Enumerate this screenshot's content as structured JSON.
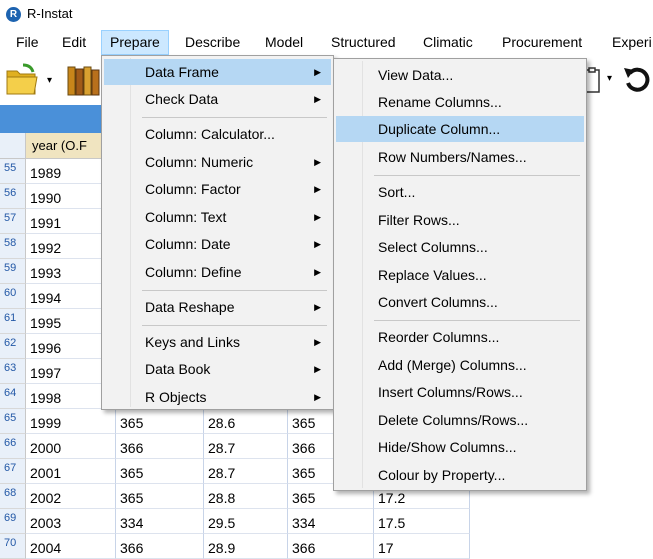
{
  "window": {
    "title": "R-Instat",
    "icon_letter": "R"
  },
  "menubar": [
    {
      "label": "File"
    },
    {
      "label": "Edit"
    },
    {
      "label": "Prepare"
    },
    {
      "label": "Describe"
    },
    {
      "label": "Model"
    },
    {
      "label": "Structured"
    },
    {
      "label": "Climatic"
    },
    {
      "label": "Procurement"
    },
    {
      "label": "Experi"
    }
  ],
  "toolbar": {
    "icons": [
      "open-folder-icon",
      "dropdown-arrow-icon",
      "books-icon",
      "clipboard-icon",
      "undo-icon"
    ]
  },
  "grid": {
    "header_first_col": "year (O.F",
    "rows": [
      {
        "num": "55",
        "cells": [
          "1989",
          "",
          "",
          "",
          ""
        ]
      },
      {
        "num": "56",
        "cells": [
          "1990",
          "",
          "",
          "",
          ""
        ]
      },
      {
        "num": "57",
        "cells": [
          "1991",
          "",
          "",
          "",
          ""
        ]
      },
      {
        "num": "58",
        "cells": [
          "1992",
          "",
          "",
          "",
          ""
        ]
      },
      {
        "num": "59",
        "cells": [
          "1993",
          "",
          "",
          "",
          ""
        ]
      },
      {
        "num": "60",
        "cells": [
          "1994",
          "",
          "",
          "",
          ""
        ]
      },
      {
        "num": "61",
        "cells": [
          "1995",
          "",
          "",
          "",
          ""
        ]
      },
      {
        "num": "62",
        "cells": [
          "1996",
          "",
          "",
          "",
          ""
        ]
      },
      {
        "num": "63",
        "cells": [
          "1997",
          "",
          "",
          "",
          ""
        ]
      },
      {
        "num": "64",
        "cells": [
          "1998",
          "",
          "",
          "",
          ""
        ]
      },
      {
        "num": "65",
        "cells": [
          "1999",
          "365",
          "28.6",
          "365",
          ""
        ]
      },
      {
        "num": "66",
        "cells": [
          "2000",
          "366",
          "28.7",
          "366",
          ""
        ]
      },
      {
        "num": "67",
        "cells": [
          "2001",
          "365",
          "28.7",
          "365",
          ""
        ]
      },
      {
        "num": "68",
        "cells": [
          "2002",
          "365",
          "28.8",
          "365",
          "17.2"
        ]
      },
      {
        "num": "69",
        "cells": [
          "2003",
          "334",
          "29.5",
          "334",
          "17.5"
        ]
      },
      {
        "num": "70",
        "cells": [
          "2004",
          "366",
          "28.9",
          "366",
          "17"
        ]
      }
    ]
  },
  "prepare_menu": {
    "items": [
      {
        "label": "Data Frame",
        "submenu": true,
        "highlighted": true
      },
      {
        "label": "Check Data",
        "submenu": true
      },
      {
        "label": "Column: Calculator...",
        "submenu": false
      },
      {
        "label": "Column: Numeric",
        "submenu": true
      },
      {
        "label": "Column: Factor",
        "submenu": true
      },
      {
        "label": "Column: Text",
        "submenu": true
      },
      {
        "label": "Column: Date",
        "submenu": true
      },
      {
        "label": "Column: Define",
        "submenu": true
      },
      {
        "label": "Data Reshape",
        "submenu": true
      },
      {
        "label": "Keys and Links",
        "submenu": true
      },
      {
        "label": "Data Book",
        "submenu": true
      },
      {
        "label": "R Objects",
        "submenu": true
      }
    ]
  },
  "data_frame_menu": {
    "items": [
      {
        "label": "View Data..."
      },
      {
        "label": "Rename Columns..."
      },
      {
        "label": "Duplicate Column...",
        "highlighted": true
      },
      {
        "label": "Row Numbers/Names..."
      },
      {
        "label": "Sort..."
      },
      {
        "label": "Filter Rows..."
      },
      {
        "label": "Select Columns..."
      },
      {
        "label": "Replace Values..."
      },
      {
        "label": "Convert Columns..."
      },
      {
        "label": "Reorder Columns..."
      },
      {
        "label": "Add (Merge) Columns..."
      },
      {
        "label": "Insert Columns/Rows..."
      },
      {
        "label": "Delete Columns/Rows..."
      },
      {
        "label": "Hide/Show Columns..."
      },
      {
        "label": "Colour by Property..."
      }
    ]
  },
  "colors": {
    "menu_highlight": "#b5d7f3",
    "menubar_active": "#cce8ff",
    "grid_header_bar": "#4a90d9",
    "row_number_text": "#2358a6"
  }
}
